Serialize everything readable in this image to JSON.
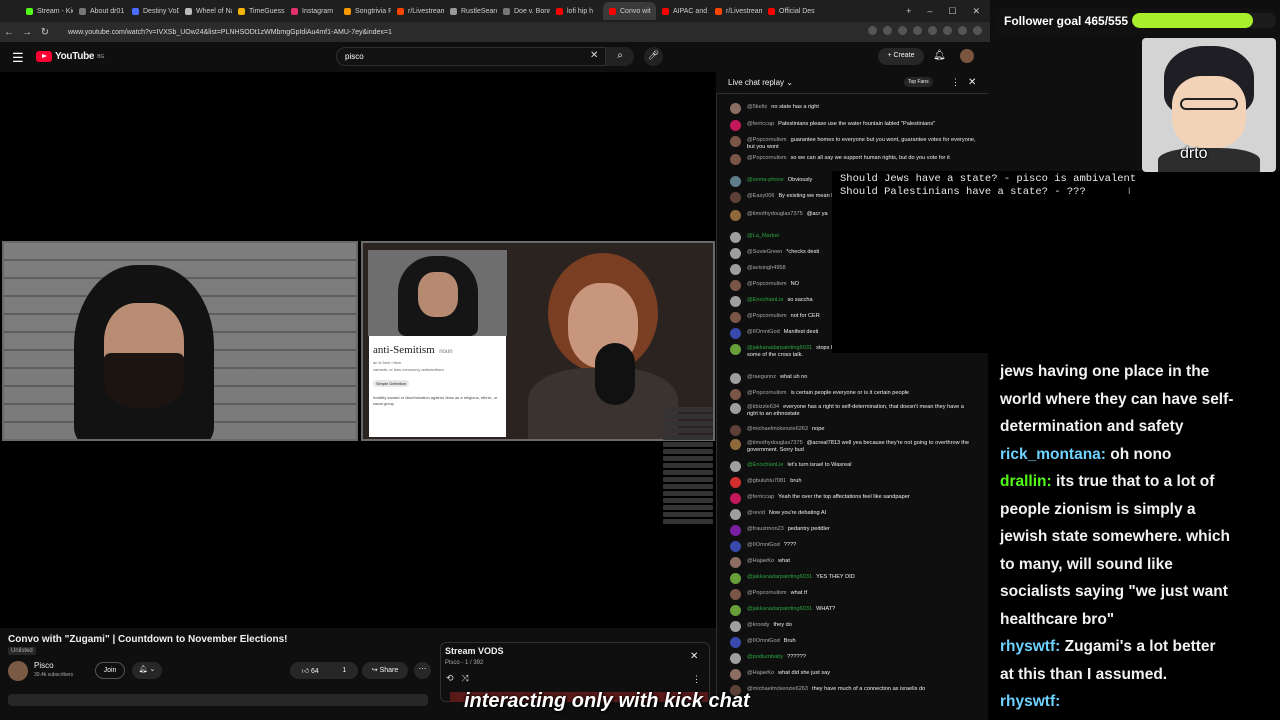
{
  "browser": {
    "tabs": [
      {
        "label": "Stream - Kick",
        "color": "#53fc18"
      },
      {
        "label": "About dr01",
        "color": "#777777"
      },
      {
        "label": "Destiny VoD",
        "color": "#4a6cff"
      },
      {
        "label": "Wheel of Na",
        "color": "#bbbbbb"
      },
      {
        "label": "TimeGuessr",
        "color": "#f4b400"
      },
      {
        "label": "Instagram",
        "color": "#e1306c"
      },
      {
        "label": "Songtrivia P",
        "color": "#ff9900"
      },
      {
        "label": "r/Livestream",
        "color": "#ff4500"
      },
      {
        "label": "RustleSearch",
        "color": "#999999"
      },
      {
        "label": "Doe v. Bonn",
        "color": "#777777"
      },
      {
        "label": "lofi hip h",
        "color": "#ff0000"
      },
      {
        "label": "Convo wit",
        "color": "#ff0000"
      },
      {
        "label": "AIPAC and A",
        "color": "#ff0000"
      },
      {
        "label": "r/Livestream",
        "color": "#ff4500"
      },
      {
        "label": "Official Desti",
        "color": "#ff0000"
      }
    ],
    "url": "www.youtube.com/watch?v=IVXSb_UOw24&list=PLNHSODt1zWMbmgGpIdiAu4mf1-AMU-7ey&index=1"
  },
  "youtube": {
    "logo_text": "YouTube",
    "logo_region": "BG",
    "search_value": "pisco",
    "create_label": "Create"
  },
  "video": {
    "title": "Convo with \"Zugami\" | Countdown to November Elections!",
    "visibility": "Unlisted",
    "channel": "Pisco",
    "subscribers": "30.4k subscribers",
    "join_label": "Join",
    "likes": "64",
    "dislikes": "1",
    "share_label": "Share",
    "dictionary": {
      "word": "anti-Semitism",
      "pos": "noun",
      "pron": "an·ti-Sem·i·tism",
      "variant_label": "variants: or less commonly antisemitism",
      "chip": "Simple Definition",
      "definition": "hostility toward or discrimination against Jews as a religious, ethnic, or racial group"
    }
  },
  "playlist": {
    "title": "Stream VODS",
    "sub": "Pisco - 1 / 392"
  },
  "chat": {
    "title": "Live chat replay",
    "top_fans": "Top Fans",
    "messages": [
      {
        "author": "@5keltz",
        "text": "no state has a right",
        "color": "#8d6e63",
        "mod": false
      },
      {
        "author": "@ferriccap",
        "text": "Palestinians please use the water fountain labled \"Palestinians\"",
        "color": "#c2185b",
        "mod": false
      },
      {
        "author": "@Popcornulism",
        "text": "guarantee homes to everyone but you wont, guarantee votes for everyone, but you wont",
        "color": "#795548",
        "mod": false
      },
      {
        "author": "@Popcornulism",
        "text": "so we can all say we support human rights, but do you vote for it",
        "color": "#795548",
        "mod": false
      },
      {
        "author": "@sema-phone",
        "text": "Obviously",
        "color": "#607d8b",
        "mod": true
      },
      {
        "author": "@Easy006",
        "text": "By existing we mean business and such",
        "color": "#5d4037",
        "mod": false
      },
      {
        "author": "@timothydouglas7375",
        "text": "@acr ya",
        "color": "#8e6a3b",
        "mod": false
      },
      {
        "author": "@La_Marker",
        "text": "",
        "color": "#9e9e9e",
        "mod": true
      },
      {
        "author": "@SuvieGreen",
        "text": "*checks desti",
        "color": "#9e9e9e",
        "mod": false
      },
      {
        "author": "@avisingh4958",
        "text": "",
        "color": "#9e9e9e",
        "mod": false
      },
      {
        "author": "@Popcornulism",
        "text": "NO",
        "color": "#795548",
        "mod": false
      },
      {
        "author": "@EnochianLie",
        "text": "so saccha",
        "color": "#9e9e9e",
        "mod": true
      },
      {
        "author": "@Popcornulism",
        "text": "not for CER",
        "color": "#795548",
        "mod": false
      },
      {
        "author": "@IIOmniGod",
        "text": "Manifest desti",
        "color": "#3949ab",
        "mod": false
      },
      {
        "author": "@jakkanadarpainting6031",
        "text": "stops being Jewish and becomes pluralistic?\" I think it will solve some of the cross talk.",
        "color": "#689f38",
        "mod": true
      },
      {
        "author": "@raegunnz",
        "text": "what uh no",
        "color": "#9e9e9e",
        "mod": false
      },
      {
        "author": "@Popcornulism",
        "text": "is certain people everyone or is it certain people",
        "color": "#795548",
        "mod": false
      },
      {
        "author": "@kbizzle634",
        "text": "everyone has a right to self-determination, that doesn't mean they have a right to an ethnostate",
        "color": "#9e9e9e",
        "mod": false
      },
      {
        "author": "@michaelmckenzie6263",
        "text": "nope",
        "color": "#5d4037",
        "mod": false
      },
      {
        "author": "@timothydouglas7375",
        "text": "@acreal7813 well yea because they're not going to overthrow the government. Sorry bud",
        "color": "#8e6a3b",
        "mod": false
      },
      {
        "author": "@EnochianLie",
        "text": "let's turn israel to Wasreal",
        "color": "#9e9e9e",
        "mod": true
      },
      {
        "author": "@gbuluhlu7081",
        "text": "bruh",
        "color": "#d32f2f",
        "mod": false
      },
      {
        "author": "@ferriccap",
        "text": "Yeah the over the top affectations feel like sandpaper",
        "color": "#c2185b",
        "mod": false
      },
      {
        "author": "@revid",
        "text": "Now you're debating AI",
        "color": "#9e9e9e",
        "mod": false
      },
      {
        "author": "@fraustmon23",
        "text": "pedantry peddler",
        "color": "#7b1fa2",
        "mod": false
      },
      {
        "author": "@IIOmniGod",
        "text": "????",
        "color": "#3949ab",
        "mod": false
      },
      {
        "author": "@HajaeKo",
        "text": "what",
        "color": "#8d6e63",
        "mod": false
      },
      {
        "author": "@jakkanadarpainting6031",
        "text": "YES THEY DID",
        "color": "#689f38",
        "mod": true
      },
      {
        "author": "@Popcornulism",
        "text": "what tf",
        "color": "#795548",
        "mod": false
      },
      {
        "author": "@jakkanadarpainting6031",
        "text": "WHAT?",
        "color": "#689f38",
        "mod": true
      },
      {
        "author": "@kroody",
        "text": "they do",
        "color": "#9e9e9e",
        "mod": false
      },
      {
        "author": "@IIOmniGod",
        "text": "Bruh",
        "color": "#3949ab",
        "mod": false
      },
      {
        "author": "@podiumbaby",
        "text": "??????",
        "color": "#9e9e9e",
        "mod": true
      },
      {
        "author": "@HajaeKo",
        "text": "what did she just say",
        "color": "#8d6e63",
        "mod": false
      },
      {
        "author": "@michaelmckenzie6263",
        "text": "they have much of a connection as israelis do",
        "color": "#5d4037",
        "mod": false
      }
    ]
  },
  "note": {
    "line1": "Should Jews have a state? - pisco is ambivalent",
    "line2": "Should Palestinians have a state? - ???"
  },
  "overlay": {
    "goal_text": "Follower goal 465/555",
    "goal_fraction": 0.838,
    "avatar_label": "drto",
    "kick_lines": [
      {
        "name": "",
        "text": "jews having one place in the"
      },
      {
        "name": "",
        "text": "world where they can have self-"
      },
      {
        "name": "",
        "text": "determination and safety"
      },
      {
        "name": "rick_montana:",
        "text": "oh nono"
      },
      {
        "name": "drallin:",
        "text": "its true that to a lot of",
        "green": true
      },
      {
        "name": "",
        "text": "people zionism is simply a"
      },
      {
        "name": "",
        "text": "jewish state somewhere. which"
      },
      {
        "name": "",
        "text": "to many, will sound like"
      },
      {
        "name": "",
        "text": "socialists saying \"we just want"
      },
      {
        "name": "",
        "text": "healthcare bro\""
      },
      {
        "name": "rhyswtf:",
        "text": "Zugami's a lot better"
      },
      {
        "name": "",
        "text": "at this than I assumed."
      },
      {
        "name": "rhyswtf:",
        "text": ""
      }
    ],
    "caption": "interacting only with kick chat"
  }
}
